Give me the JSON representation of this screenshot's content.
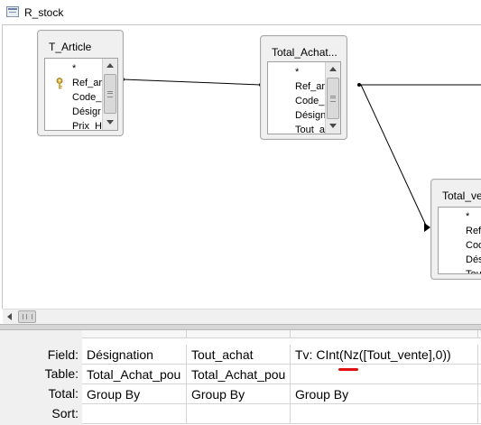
{
  "window": {
    "title": "R_stock"
  },
  "tables": [
    {
      "name": "T_Article",
      "fields": [
        "*",
        "Ref_ar",
        "Code_",
        "Désigr",
        "Prix_HT"
      ],
      "primary_key_field": "Ref_ar"
    },
    {
      "name": "Total_Achat...",
      "fields": [
        "*",
        "Ref_ar",
        "Code_",
        "Désign",
        "Tout_a"
      ]
    },
    {
      "name": "Total_ve",
      "fields": [
        "*",
        "Ref_",
        "Cod",
        "Dési",
        "Tou"
      ]
    }
  ],
  "grid": {
    "row_labels": [
      "Field:",
      "Table:",
      "Total:",
      "Sort:"
    ],
    "columns": [
      {
        "field": "Désignation",
        "table": "Total_Achat_pou",
        "total": "Group By",
        "sort": ""
      },
      {
        "field": "Tout_achat",
        "table": "Total_Achat_pou",
        "total": "Group By",
        "sort": ""
      },
      {
        "field": "Tv: CInt(Nz([Tout_vente],0))",
        "table": "",
        "total": "Group By",
        "sort": ""
      },
      {
        "field": "",
        "table": "",
        "total": "",
        "sort": ""
      }
    ]
  },
  "colors": {
    "join_line": "#000000",
    "spell_error": "#e01010",
    "table_box": "#f0f0f0"
  }
}
